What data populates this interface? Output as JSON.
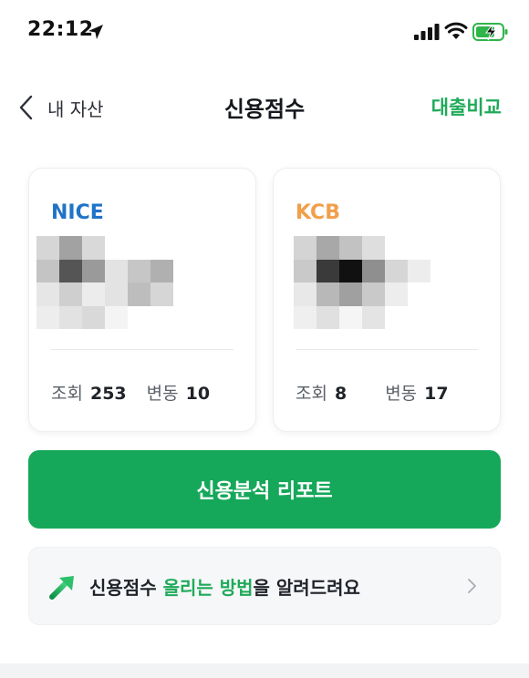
{
  "status_bar": {
    "time": "22:12"
  },
  "nav": {
    "back_label": "내 자산",
    "title": "신용점수",
    "action": "대출비교"
  },
  "cards": [
    {
      "agency": "NICE",
      "agency_color": "#1f74c7",
      "inquiry_label": "조회",
      "inquiry_value": "253",
      "change_label": "변동",
      "change_value": "10"
    },
    {
      "agency": "KCB",
      "agency_color": "#f0a04b",
      "inquiry_label": "조회",
      "inquiry_value": "8",
      "change_label": "변동",
      "change_value": "17"
    }
  ],
  "report_button": {
    "label": "신용분석 리포트"
  },
  "tip": {
    "before": "신용점수 ",
    "highlight": "올리는 방법",
    "after": "을 알려드려요"
  },
  "colors": {
    "accent": "#1faa59",
    "button_bg": "#16a85a",
    "nice": "#1f74c7",
    "kcb": "#f0a04b"
  },
  "icons": [
    "location-arrow-icon",
    "cellular-signal-icon",
    "wifi-icon",
    "battery-charging-icon",
    "chevron-left-icon",
    "trend-up-icon",
    "chevron-right-icon"
  ]
}
